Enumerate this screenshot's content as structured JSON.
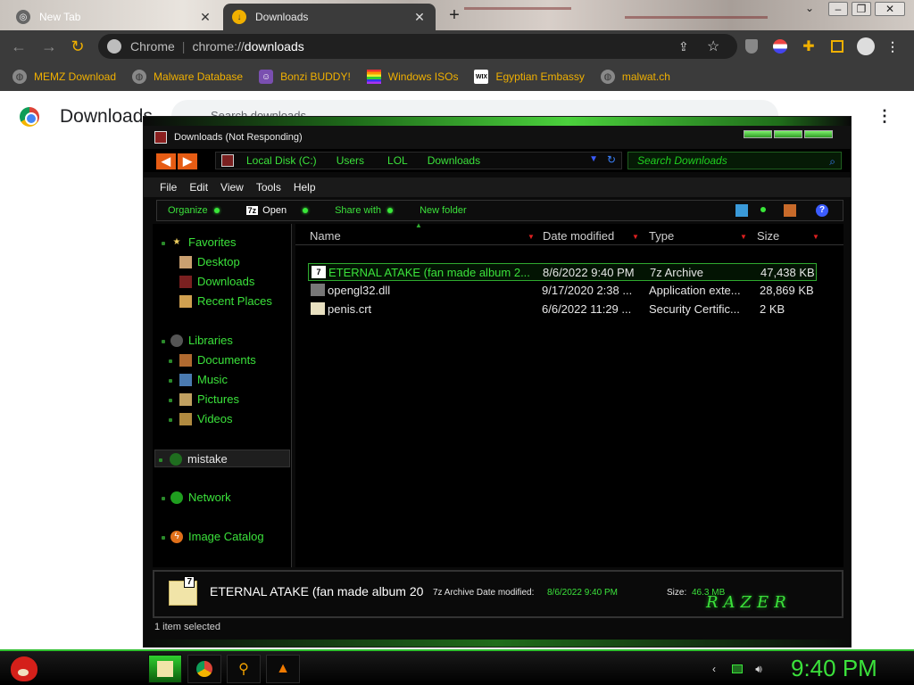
{
  "chrome": {
    "tabs": [
      {
        "label": "New Tab",
        "active": false
      },
      {
        "label": "Downloads",
        "active": true
      }
    ],
    "omnibox": {
      "site": "Chrome",
      "url_prefix": "chrome://",
      "url_host": "downloads"
    },
    "bookmarks": [
      {
        "label": "MEMZ Download",
        "icon": "globe-icon"
      },
      {
        "label": "Malware Database",
        "icon": "globe-icon"
      },
      {
        "label": "Bonzi BUDDY!",
        "icon": "bonzi-icon"
      },
      {
        "label": "Windows ISOs",
        "icon": "windows-flag-icon"
      },
      {
        "label": "Egyptian Embassy",
        "icon": "wix-icon"
      },
      {
        "label": "malwat.ch",
        "icon": "globe-icon"
      }
    ],
    "wix_glyph": "WIX"
  },
  "downloads_page": {
    "title": "Downloads",
    "search_placeholder": "Search downloads"
  },
  "explorer": {
    "title": "Downloads (Not Responding)",
    "breadcrumb": [
      "Local Disk (C:)",
      "Users",
      "LOL",
      "Downloads"
    ],
    "search_placeholder": "Search Downloads",
    "menus": [
      "File",
      "Edit",
      "View",
      "Tools",
      "Help"
    ],
    "commands": {
      "organize": "Organize",
      "open": "Open",
      "open_badge": "7z",
      "share_with": "Share with",
      "new_folder": "New folder"
    },
    "nav": {
      "favorites": "Favorites",
      "desktop": "Desktop",
      "downloads": "Downloads",
      "recent_places": "Recent Places",
      "libraries": "Libraries",
      "documents": "Documents",
      "music": "Music",
      "pictures": "Pictures",
      "videos": "Videos",
      "mistake": "mistake",
      "network": "Network",
      "image_catalog": "Image Catalog"
    },
    "columns": {
      "name": "Name",
      "date": "Date modified",
      "type": "Type",
      "size": "Size"
    },
    "files": [
      {
        "name": "ETERNAL ATAKE (fan made album 2...",
        "date": "8/6/2022 9:40 PM",
        "type": "7z Archive",
        "size": "47,438 KB",
        "icon": "7z-icon",
        "selected": true
      },
      {
        "name": "opengl32.dll",
        "date": "9/17/2020 2:38 ...",
        "type": "Application exte...",
        "size": "28,869 KB",
        "icon": "dll-icon",
        "selected": false
      },
      {
        "name": "penis.crt",
        "date": "6/6/2022 11:29 ...",
        "type": "Security Certific...",
        "size": "2 KB",
        "icon": "certificate-icon",
        "selected": false
      }
    ],
    "file_icon_glyph": "7",
    "details": {
      "name": "ETERNAL ATAKE (fan made album 20",
      "type_label": "7z Archive Date modified:",
      "date_value": "8/6/2022 9:40 PM",
      "size_label": "Size:",
      "size_value": "46.3 MB",
      "brand": "RAZER"
    },
    "status": "1 item selected"
  },
  "taskbar": {
    "clock": "9:40 PM",
    "apps": [
      "explorer-icon",
      "chrome-icon",
      "search-icon",
      "vlc-icon"
    ]
  },
  "colors": {
    "accent_green": "#3be23b",
    "bookmark_gold": "#f0b000",
    "toolbar": "#3b3b3b"
  }
}
